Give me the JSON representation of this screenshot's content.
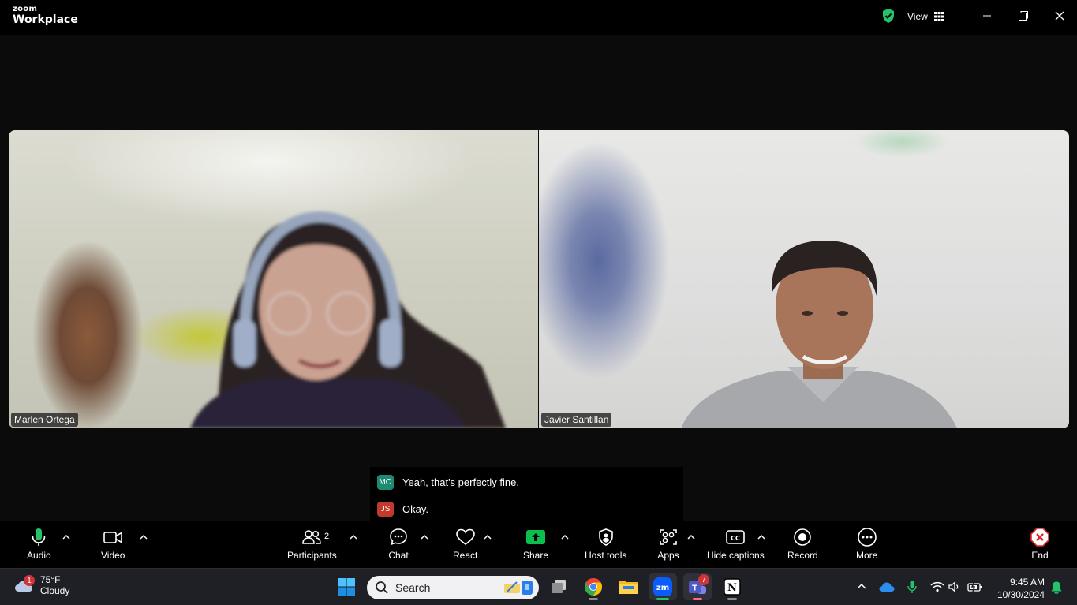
{
  "titlebar": {
    "brand": "zoom",
    "product": "Workplace",
    "view_label": "View",
    "shield_color": "#23c36b"
  },
  "participants": [
    {
      "name": "Marlen Ortega"
    },
    {
      "name": "Javier Santillan"
    }
  ],
  "captions": [
    {
      "initials": "MO",
      "color": "#1f8a73",
      "text": "Yeah, that's perfectly fine."
    },
    {
      "initials": "JS",
      "color": "#c23a2c",
      "text": "Okay."
    }
  ],
  "toolbar": {
    "audio": "Audio",
    "video": "Video",
    "participants": "Participants",
    "participants_count": "2",
    "chat": "Chat",
    "react": "React",
    "share": "Share",
    "host_tools": "Host tools",
    "apps": "Apps",
    "hide_captions": "Hide captions",
    "record": "Record",
    "more": "More",
    "end": "End",
    "share_color": "#0bbf4c",
    "end_color": "#e02828",
    "mic_color": "#23c36b"
  },
  "taskbar": {
    "weather_badge": "1",
    "temperature": "75°F",
    "condition": "Cloudy",
    "search_placeholder": "Search",
    "teams_badge": "7",
    "time": "9:45 AM",
    "date": "10/30/2024"
  }
}
